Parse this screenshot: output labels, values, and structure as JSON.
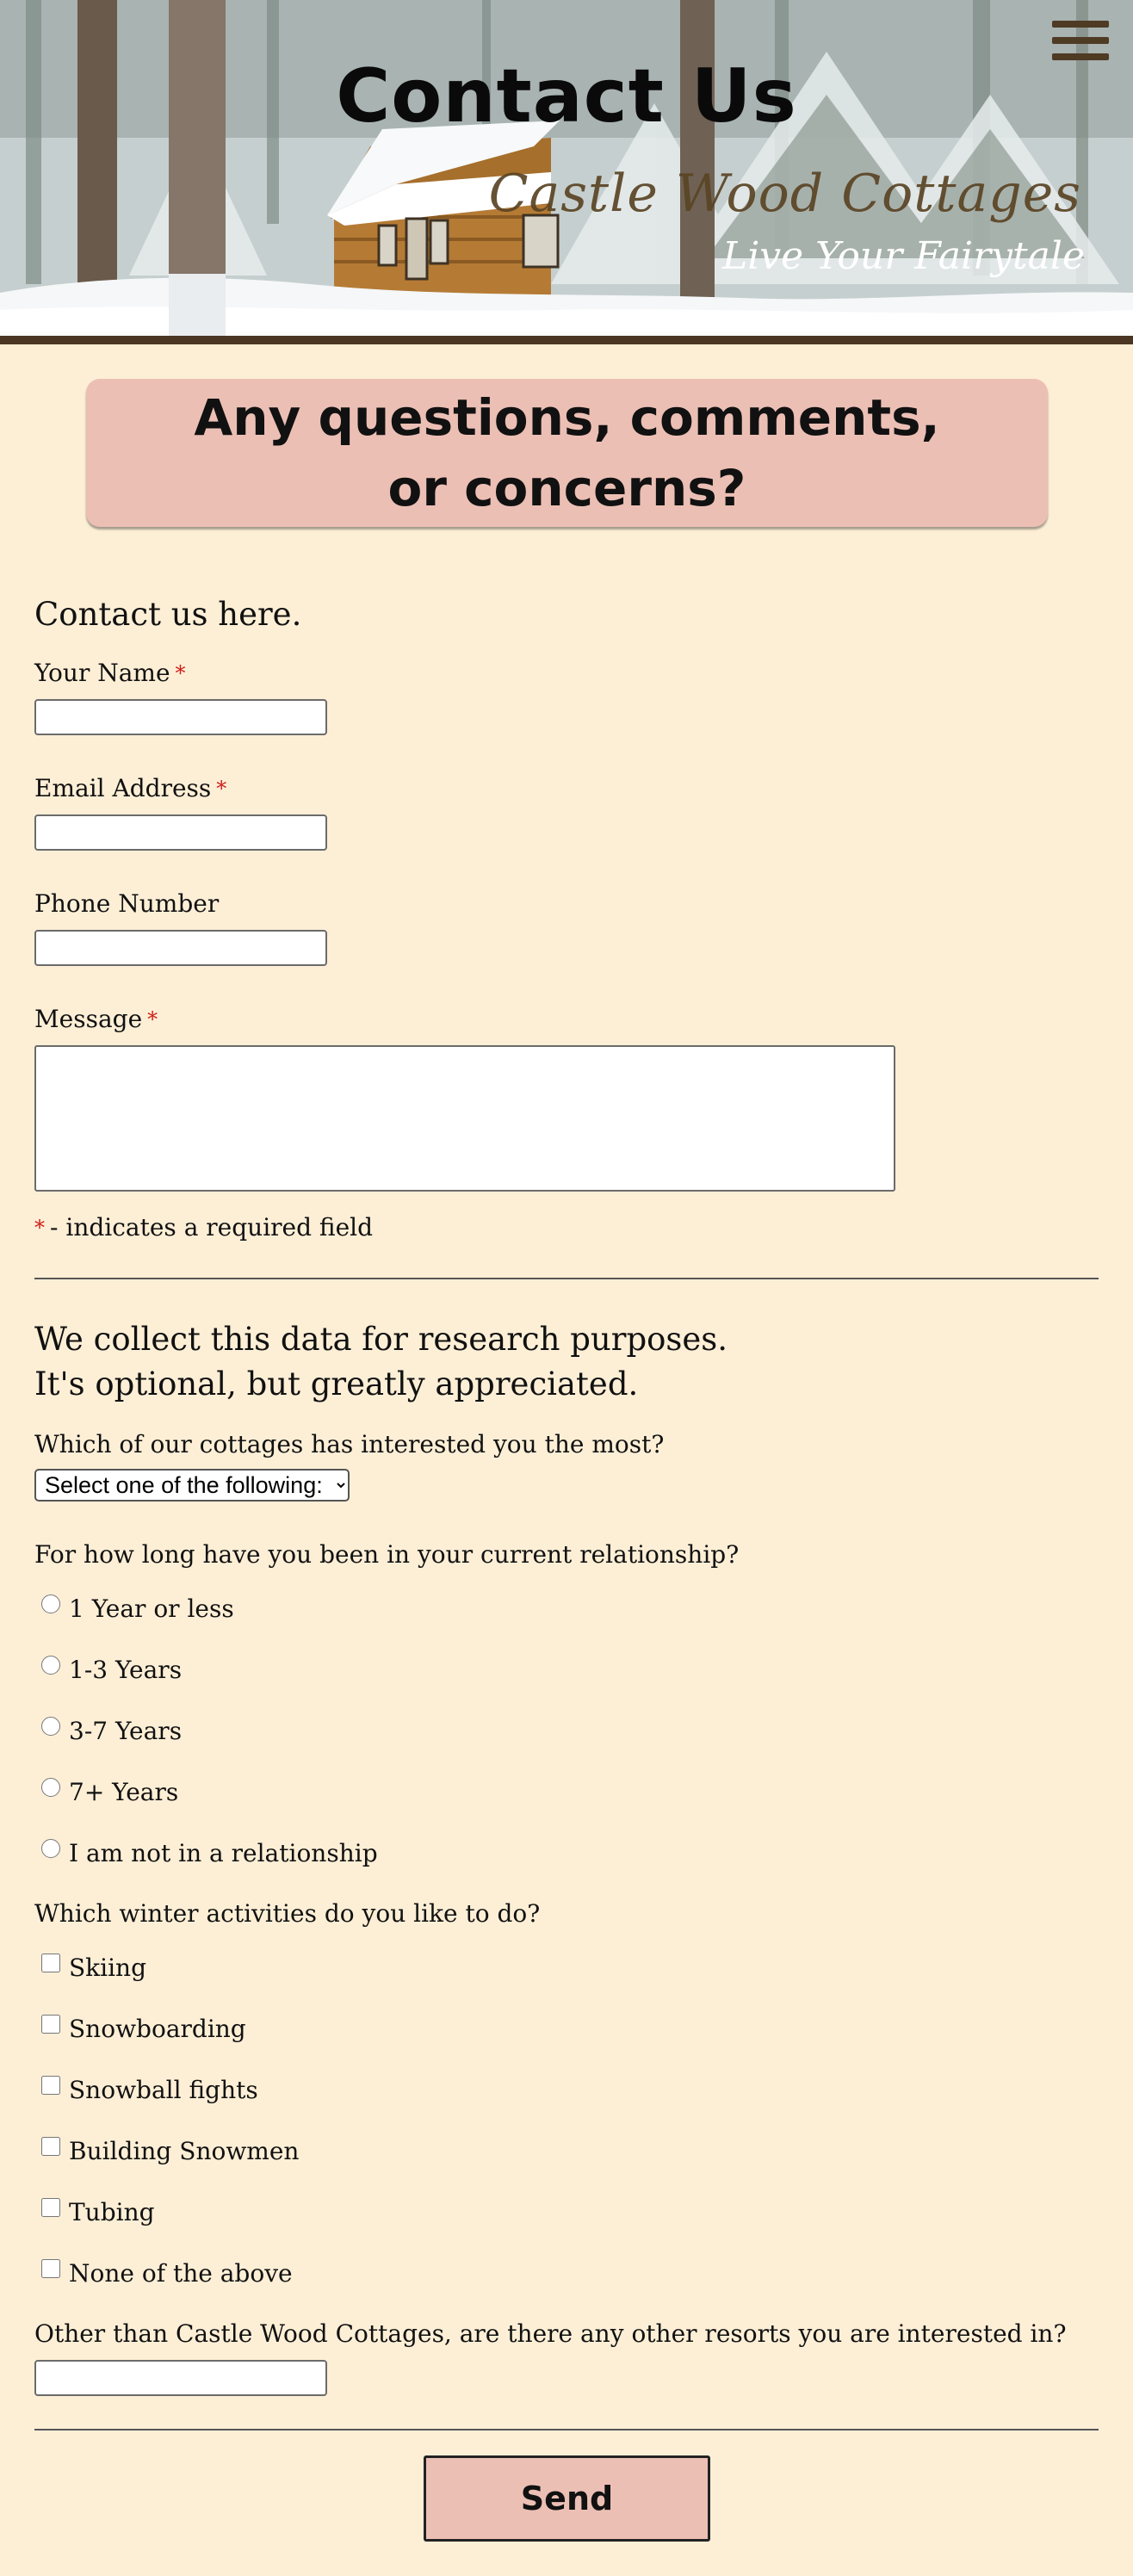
{
  "header": {
    "page_title": "Contact Us",
    "brand_name": "Castle Wood Cottages",
    "tagline": "Live Your Fairytale",
    "menu_icon": "hamburger-menu-icon"
  },
  "banner": {
    "line1": "Any questions, comments,",
    "line2": "or concerns?"
  },
  "contact_form": {
    "heading": "Contact us here.",
    "required_marker": "*",
    "name_label": "Your Name",
    "email_label": "Email Address",
    "phone_label": "Phone Number",
    "message_label": "Message",
    "required_note": "- indicates a required field"
  },
  "survey": {
    "heading_line1": "We collect this data for research purposes.",
    "heading_line2": "It's optional, but greatly appreciated.",
    "cottage_question": "Which of our cottages has interested you the most?",
    "cottage_select_value": "Select one of the following:",
    "relationship_question": "For how long have you been in your current relationship?",
    "relationship_options": [
      "1 Year or less",
      "1-3 Years",
      "3-7 Years",
      "7+ Years",
      "I am not in a relationship"
    ],
    "activities_question": "Which winter activities do you like to do?",
    "activity_options": [
      "Skiing",
      "Snowboarding",
      "Snowball fights",
      "Building Snowmen",
      "Tubing",
      "None of the above"
    ],
    "resorts_question": "Other than Castle Wood Cottages, are there any other resorts you are interested in?"
  },
  "send_button_label": "Send",
  "colors": {
    "page_background": "#fdefd6",
    "accent_pink": "#ecbfb5",
    "header_brown": "#4a3622",
    "required_red": "#d0201c"
  }
}
